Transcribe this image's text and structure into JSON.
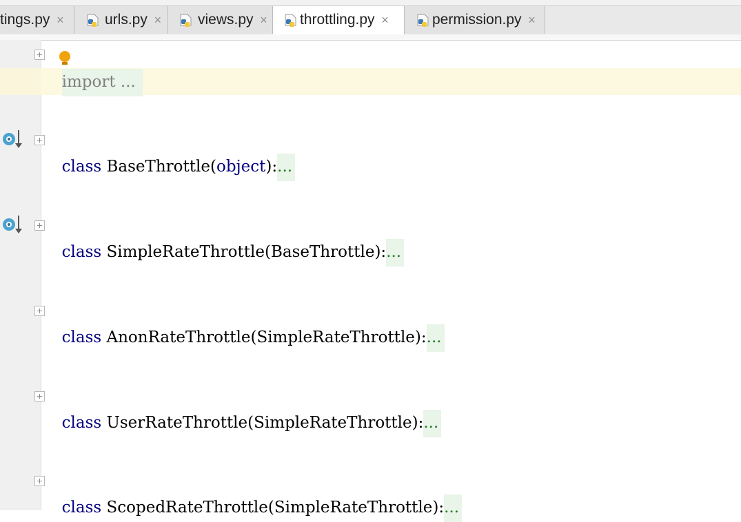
{
  "tabs": [
    {
      "label": "tings.py",
      "active": false
    },
    {
      "label": "urls.py",
      "active": false
    },
    {
      "label": "views.py",
      "active": false
    },
    {
      "label": "throttling.py",
      "active": true
    },
    {
      "label": "permission.py",
      "active": false
    }
  ],
  "tab_close_glyph": "×",
  "editor": {
    "import_line": {
      "keyword": "import",
      "folded": "..."
    },
    "classes": [
      {
        "keyword": "class",
        "name": "BaseThrottle",
        "open": "(",
        "base": "object",
        "close": "):",
        "folded": "...",
        "base_is_builtin": true,
        "has_override_marker": true
      },
      {
        "keyword": "class",
        "name": "SimpleRateThrottle",
        "open": "(",
        "base": "BaseThrottle",
        "close": "):",
        "folded": "...",
        "has_override_marker": true
      },
      {
        "keyword": "class",
        "name": "AnonRateThrottle",
        "open": "(",
        "base": "SimpleRateThrottle",
        "close": "):",
        "folded": "..."
      },
      {
        "keyword": "class",
        "name": "UserRateThrottle",
        "open": "(",
        "base": "SimpleRateThrottle",
        "close": "):",
        "folded": "..."
      },
      {
        "keyword": "class",
        "name": "ScopedRateThrottle",
        "open": "(",
        "base": "SimpleRateThrottle",
        "close": "):",
        "folded": "..."
      }
    ]
  },
  "colors": {
    "keyword": "#000080",
    "folded_text": "#2a7d2a",
    "folded_bg": "#e8f5e8",
    "caret_line": "#fdf8e0",
    "gutter": "#f0f0f0",
    "bulb": "#f0a30a",
    "override_marker": "#4aa3d0"
  },
  "icons": {
    "tab_file": "python-file-icon",
    "gutter_marker": "overridden-method-icon",
    "intention": "lightbulb-icon",
    "fold": "fold-expand-icon"
  }
}
